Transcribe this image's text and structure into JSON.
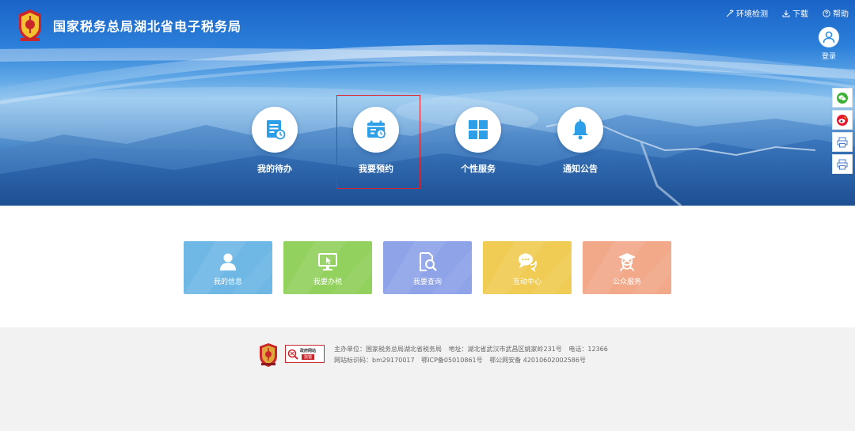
{
  "header": {
    "title": "国家税务总局湖北省电子税务局",
    "links": [
      {
        "label": "环境检测",
        "icon": "tools-icon"
      },
      {
        "label": "下载",
        "icon": "download-icon"
      },
      {
        "label": "帮助",
        "icon": "help-icon"
      }
    ],
    "login_label": "登录"
  },
  "nav": {
    "items": [
      {
        "label": "我的待办",
        "icon": "todo-list-icon"
      },
      {
        "label": "我要预约",
        "icon": "calendar-icon"
      },
      {
        "label": "个性服务",
        "icon": "grid-icon"
      },
      {
        "label": "通知公告",
        "icon": "bell-icon"
      }
    ],
    "highlighted_index": 1
  },
  "side_bar": {
    "buttons": [
      "wechat-icon",
      "weibo-icon",
      "print-icon",
      "print-icon"
    ]
  },
  "cards": [
    {
      "label": "我的信息",
      "icon": "person-icon",
      "color": "#6fb8e6"
    },
    {
      "label": "我要办税",
      "icon": "monitor-icon",
      "color": "#93d15f"
    },
    {
      "label": "我要查询",
      "icon": "search-doc-icon",
      "color": "#8fa3e8"
    },
    {
      "label": "互动中心",
      "icon": "chat-icon",
      "color": "#f0cc54"
    },
    {
      "label": "公众服务",
      "icon": "scholar-icon",
      "color": "#f2a98a"
    }
  ],
  "footer": {
    "sponsor": "主办单位：国家税务总局湖北省税务局",
    "address": "地址：湖北省武汉市武昌区姚家岭231号",
    "phone": "电话：12366",
    "site_id": "网站标识码：bm29170017",
    "icp": "鄂ICP备05010861号",
    "police": "鄂公网安备 42010602002586号",
    "gov_badge_top": "政府网站",
    "gov_badge_bottom": "找错"
  },
  "colors": {
    "accent_red": "#e0202a",
    "footer_bg": "#f2f2f2",
    "icon_blue": "#2d9ee8"
  }
}
